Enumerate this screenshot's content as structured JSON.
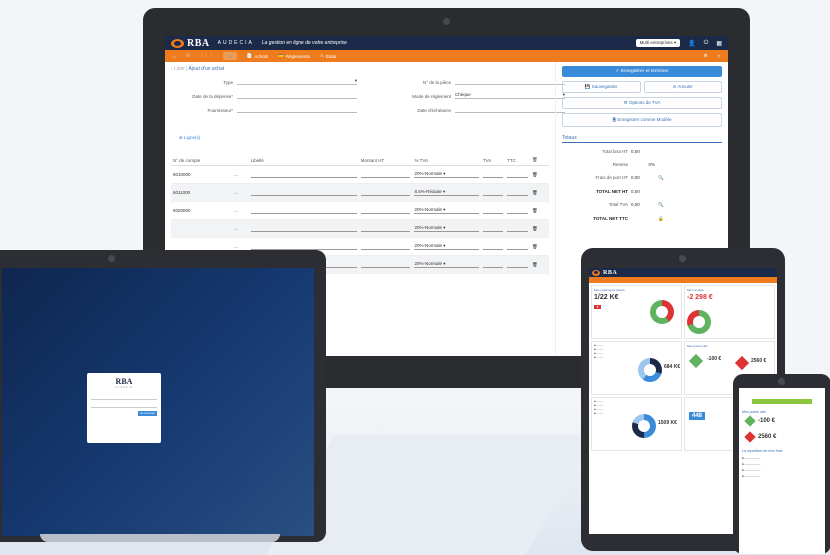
{
  "app": {
    "brand": "RBA",
    "brand2": "AUDECIA",
    "tagline": "La gestion en ligne de votre entreprise",
    "company_select": "Multi entreprises"
  },
  "menu": {
    "items": [
      "Achats",
      "Règlements",
      "États"
    ]
  },
  "breadcrumb": {
    "root": "Liste",
    "sep": "|",
    "current": "Ajout d'un achat"
  },
  "form": {
    "type_label": "Type",
    "piece_label": "N° de la pièce",
    "date_label": "Date de la dépense",
    "mode_label": "Mode de règlement",
    "mode_value": "Chèque",
    "supplier_label": "Fournisseur",
    "due_label": "Date d'échéance"
  },
  "add_line": "⊕ Ligne(s)",
  "table": {
    "headers": [
      "N° de compte",
      "Libellé",
      "Montant HT",
      "% TVA",
      "TVA",
      "TTC"
    ],
    "rows": [
      {
        "account": "6010000",
        "tva": "20%-Normale"
      },
      {
        "account": "6011000",
        "tva": "8.5%-Réduite"
      },
      {
        "account": "6020000",
        "tva": "20%-Normale"
      },
      {
        "account": "",
        "tva": "20%-Normale"
      },
      {
        "account": "",
        "tva": "20%-Normale"
      },
      {
        "account": "",
        "tva": "20%-Normale"
      }
    ]
  },
  "actions": {
    "save_finish": "✓ Enregistrer et terminer",
    "save": "Sauvegarder",
    "cancel": "Annuler",
    "tva_options": "Options de TVA",
    "save_model": "Enregistrer comme Modèle"
  },
  "totals": {
    "title": "Totaux",
    "rows": [
      {
        "label": "Total brut HT",
        "value": "0,00",
        "strong": false
      },
      {
        "label": "Remise",
        "value": "0%",
        "strong": false
      },
      {
        "label": "Frais de port HT",
        "value": "0,00",
        "strong": false
      },
      {
        "label": "TOTAL NET HT",
        "value": "0,00",
        "strong": true
      },
      {
        "label": "Total TVA",
        "value": "0,00",
        "strong": false
      },
      {
        "label": "TOTAL NET TTC",
        "value": "",
        "strong": true
      }
    ]
  },
  "laptop": {
    "login_logo": "RBA",
    "login_sub": "AUDECIA",
    "login_btn": "Se connecter"
  },
  "tablet": {
    "card1": {
      "title": "Mes règlements clients",
      "value": "1/22 K€"
    },
    "card2": {
      "title": "Mon résultat",
      "value": "-2 298 €"
    },
    "card3": {
      "title": "Mes points clés",
      "value1": "-100 €",
      "value2": "2560 €"
    },
    "donut1": {
      "value": "684 K€"
    },
    "donut2": {
      "value": "1509 K€"
    },
    "kpi": "448"
  },
  "phone": {
    "section1": "Mes points clés",
    "value1": "-100 €",
    "value2": "2560 €",
    "section2": "La répartition de mes frais"
  },
  "colors": {
    "navy": "#1c2a4a",
    "orange": "#ef7b1f",
    "blue": "#3a8bd9",
    "green": "#2e9a4a",
    "red": "#d33333"
  }
}
